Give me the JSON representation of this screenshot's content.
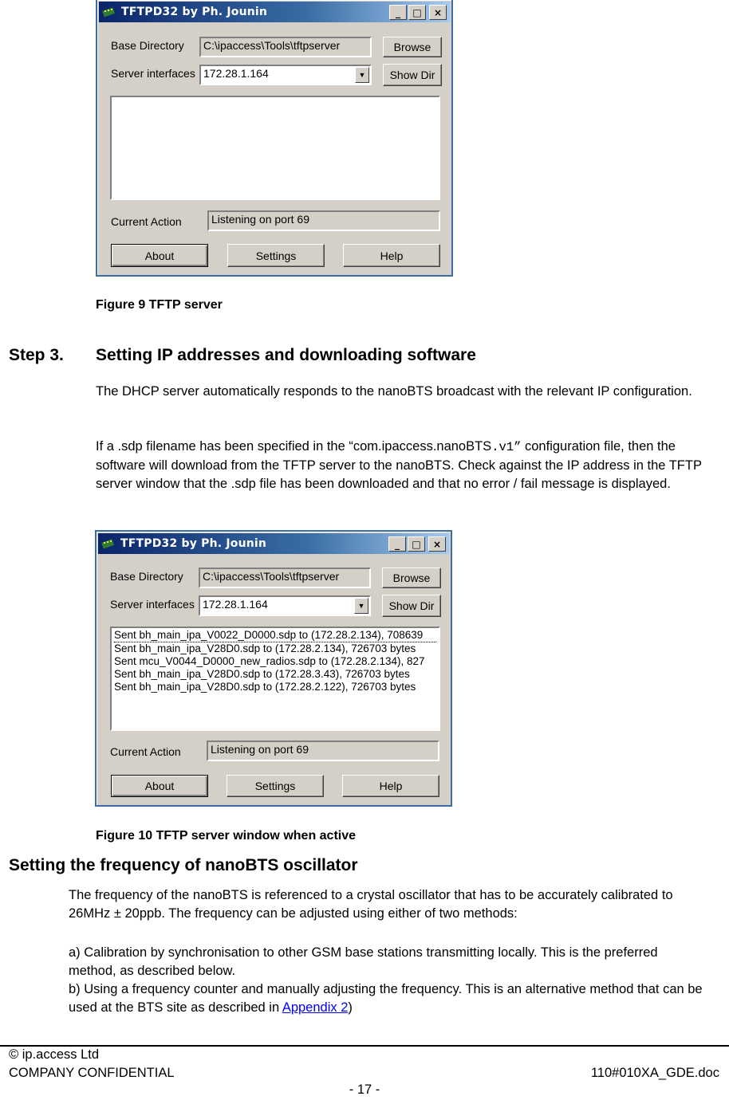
{
  "dialogs": [
    {
      "title": "TFTPD32 by Ph. Jounin",
      "window_buttons": {
        "minimize": "_",
        "maximize": "□",
        "close": "×"
      },
      "base_directory_label": "Base Directory",
      "base_directory_value": "C:\\ipaccess\\Tools\\tftpserver",
      "browse_label": "Browse",
      "server_interfaces_label": "Server interfaces",
      "server_interfaces_value": "172.28.1.164",
      "show_dir_label": "Show Dir",
      "log": [],
      "current_action_label": "Current Action",
      "current_action_value": "Listening on port 69",
      "about_label": "About",
      "settings_label": "Settings",
      "help_label": "Help"
    },
    {
      "title": "TFTPD32 by Ph. Jounin",
      "window_buttons": {
        "minimize": "_",
        "maximize": "□",
        "close": "×"
      },
      "base_directory_label": "Base Directory",
      "base_directory_value": "C:\\ipaccess\\Tools\\tftpserver",
      "browse_label": "Browse",
      "server_interfaces_label": "Server interfaces",
      "server_interfaces_value": "172.28.1.164",
      "show_dir_label": "Show Dir",
      "log": [
        "Sent bh_main_ipa_V0022_D0000.sdp to  (172.28.2.134), 708639",
        "Sent bh_main_ipa_V28D0.sdp to  (172.28.2.134), 726703 bytes",
        "Sent mcu_V0044_D0000_new_radios.sdp to  (172.28.2.134), 827",
        "Sent bh_main_ipa_V28D0.sdp to  (172.28.3.43), 726703 bytes",
        "Sent bh_main_ipa_V28D0.sdp to  (172.28.2.122), 726703 bytes"
      ],
      "current_action_label": "Current Action",
      "current_action_value": "Listening on port 69",
      "about_label": "About",
      "settings_label": "Settings",
      "help_label": "Help"
    }
  ],
  "figure9_caption": "Figure 9 TFTP server",
  "step3": {
    "number": "Step 3.",
    "title": "Setting IP addresses and downloading software",
    "para1": "The DHCP server automatically responds to the nanoBTS broadcast with the relevant IP configuration.",
    "para2_before": "If a .sdp filename has been specified in the “com.ipaccess.nanoBTS",
    "para2_mono": ".v1”",
    "para2_after": " configuration file, then the software will download from the TFTP server to the nanoBTS. Check against the IP address in the TFTP server window that the .sdp file has been downloaded and that no error / fail message is displayed."
  },
  "figure10_caption": "Figure 10 TFTP server window when active",
  "oscillator": {
    "heading": "Setting the frequency of nanoBTS oscillator",
    "para1": "The frequency of the nanoBTS is referenced to a crystal oscillator that has to be accurately calibrated to 26MHz ± 20ppb. The frequency can be adjusted using either of two methods:",
    "item_a": "a) Calibration by synchronisation to other GSM base stations transmitting locally. This is the preferred method, as described below.",
    "item_b_before": "b) Using a frequency counter and manually adjusting the frequency. This is an alternative method that can be used at the BTS site as described in ",
    "item_b_link": "Appendix 2",
    "item_b_after": ")"
  },
  "footer": {
    "copyright": "© ip.access Ltd",
    "confidential": "COMPANY CONFIDENTIAL",
    "doc_id": "110#010XA_GDE.doc",
    "page": "- 17 -"
  },
  "colors": {
    "titlebar_start": "#0a246a",
    "titlebar_end": "#a6caf0",
    "dialog_face": "#d4d0c8",
    "link": "#0000ff"
  }
}
